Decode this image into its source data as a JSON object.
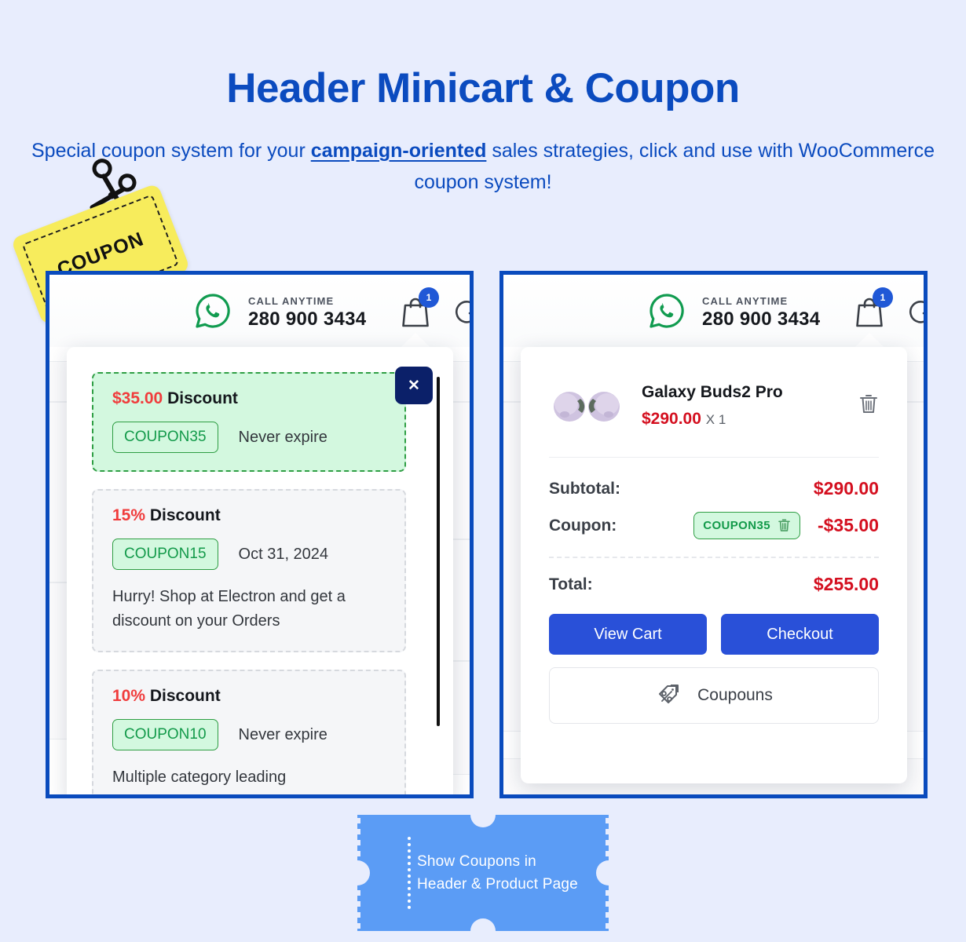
{
  "header": {
    "title": "Header Minicart & Coupon",
    "subtitle_prefix": "Special coupon system for your ",
    "subtitle_emphasis": "campaign-oriented",
    "subtitle_suffix": " sales strategies, click and use with WooCommerce coupon system!"
  },
  "coupon_badge": {
    "label": "COUPON"
  },
  "store_header": {
    "call_label": "CALL ANYTIME",
    "phone": "280 900 3434",
    "cart_count": "1"
  },
  "coupons_dropdown": {
    "close_label": "✕",
    "items": [
      {
        "amount": "$35.00",
        "discount_word": "Discount",
        "code": "COUPON35",
        "expiry": "Never expire",
        "description": "",
        "active": true
      },
      {
        "amount": "15%",
        "discount_word": "Discount",
        "code": "COUPON15",
        "expiry": "Oct 31, 2024",
        "description": "Hurry! Shop at Electron and get a discount on your Orders",
        "active": false
      },
      {
        "amount": "10%",
        "discount_word": "Discount",
        "code": "COUPON10",
        "expiry": "Never expire",
        "description": "Multiple category leading",
        "active": false
      }
    ]
  },
  "minicart": {
    "product": {
      "name": "Galaxy Buds2 Pro",
      "price": "$290.00",
      "quantity": "X 1"
    },
    "subtotal_label": "Subtotal:",
    "subtotal_value": "$290.00",
    "coupon_label": "Coupon:",
    "coupon_code": "COUPON35",
    "coupon_value": "-$35.00",
    "total_label": "Total:",
    "total_value": "$255.00",
    "view_cart_label": "View Cart",
    "checkout_label": "Checkout",
    "coupons_button_label": "Coupouns"
  },
  "ticket": {
    "line1": "Show Coupons in",
    "line2": "Header & Product Page"
  },
  "colors": {
    "page_bg": "#e8edfd",
    "brand_blue": "#0b4bbf",
    "panel_border": "#0a4bbd",
    "button_blue": "#2950d8",
    "accent_red": "#d40f1f",
    "coupon_green": "#2f9e44",
    "coupon_green_bg": "#d3f8df",
    "badge_yellow": "#f7ec5c",
    "ticket_blue": "#5b9cf5",
    "close_navy": "#0b2069"
  }
}
